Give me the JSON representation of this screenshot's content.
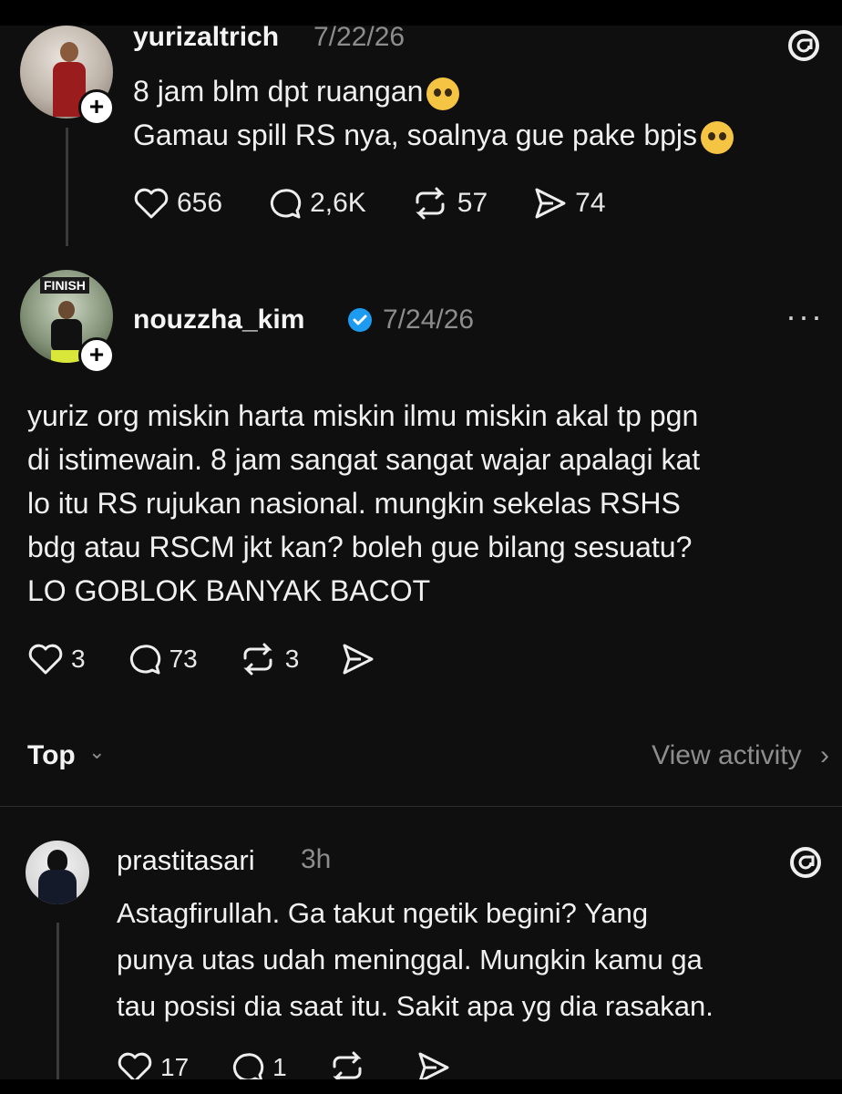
{
  "posts": [
    {
      "username": "yurizaltrich",
      "date": "7/22/26",
      "lines": [
        "8 jam blm dpt ruangan",
        "Gamau spill RS nya, soalnya gue pake bpjs"
      ],
      "likes": "656",
      "replies": "2,6K",
      "reposts": "57",
      "shares": "74"
    },
    {
      "username": "nouzzha_kim",
      "date": "7/24/26",
      "avatar_text": "FINISH",
      "lines": [
        "yuriz org miskin harta miskin ilmu miskin akal tp pgn",
        "di istimewain. 8 jam sangat sangat wajar apalagi kat",
        "lo itu RS rujukan nasional. mungkin sekelas RSHS",
        "bdg atau RSCM jkt kan? boleh gue bilang sesuatu?",
        "LO GOBLOK BANYAK BACOT"
      ],
      "likes": "3",
      "replies": "73",
      "reposts": "3",
      "more": "···"
    },
    {
      "username": "prastitasari",
      "date": "3h",
      "lines": [
        "Astagfirullah. Ga takut ngetik begini? Yang",
        "punya utas udah meninggal. Mungkin kamu ga",
        "tau posisi dia saat itu. Sakit apa yg dia rasakan."
      ],
      "likes": "17",
      "replies": "1"
    }
  ],
  "sort": {
    "label": "Top",
    "chevron": "⌄"
  },
  "view_activity": {
    "label": "View activity",
    "chevron": "›"
  },
  "plus": "+",
  "icons": [
    "threads-icon",
    "heart-icon",
    "comment-icon",
    "repost-icon",
    "share-icon",
    "verified-badge-icon",
    "more-icon"
  ],
  "colors": {
    "background": "#0f0f0f",
    "verified": "#1d9bf0",
    "muted": "#8d8d8d"
  }
}
